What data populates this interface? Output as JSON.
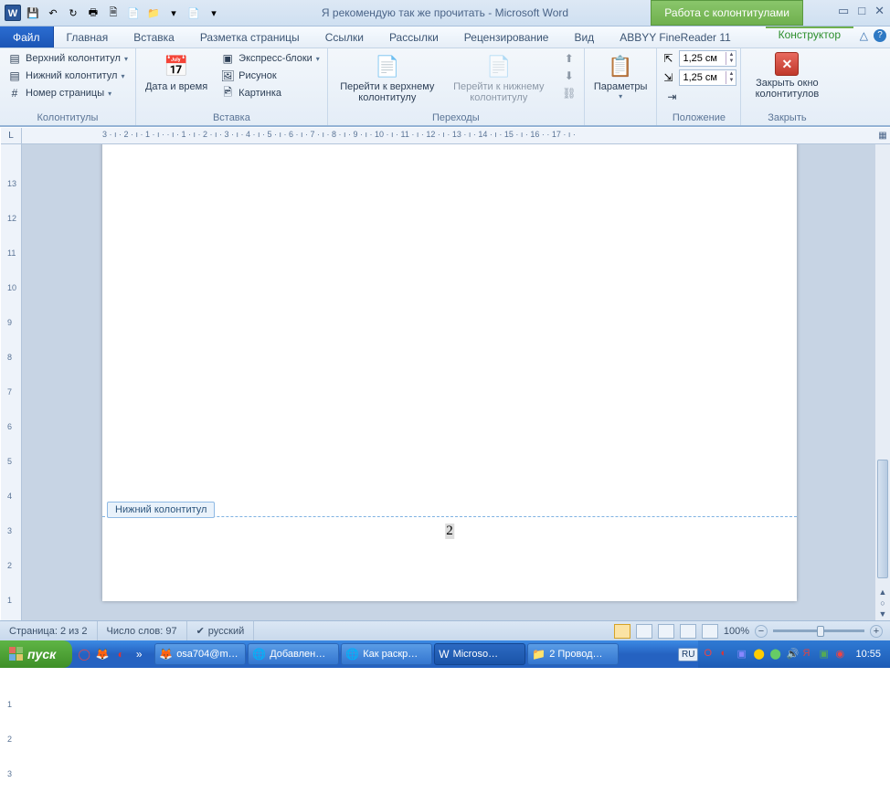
{
  "title": "Я рекомендую так же прочитать - Microsoft Word",
  "contextTab": "Работа с колонтитулами",
  "tabs": {
    "file": "Файл",
    "home": "Главная",
    "insert": "Вставка",
    "layout": "Разметка страницы",
    "refs": "Ссылки",
    "mail": "Рассылки",
    "review": "Рецензирование",
    "view": "Вид",
    "abbyy": "ABBYY FineReader 11",
    "constructor": "Конструктор"
  },
  "ribbon": {
    "group1": {
      "label": "Колонтитулы",
      "topHeader": "Верхний колонтитул",
      "bottomHeader": "Нижний колонтитул",
      "pageNum": "Номер страницы"
    },
    "group2": {
      "label": "Вставка",
      "datetime": "Дата и время",
      "express": "Экспресс-блоки",
      "picture": "Рисунок",
      "clipart": "Картинка"
    },
    "group3": {
      "label": "Переходы",
      "goTop": "Перейти к верхнему колонтитулу",
      "goBottom": "Перейти к нижнему колонтитулу"
    },
    "group4": {
      "paramsLabel": "Параметры"
    },
    "group5": {
      "label": "Положение",
      "val1": "1,25 см",
      "val2": "1,25 см"
    },
    "group6": {
      "label": "Закрыть",
      "closeBtn": "Закрыть окно колонтитулов"
    }
  },
  "hruler": "3 · ı · 2 · ı · 1 · ı ·   · ı · 1 · ı · 2 · ı · 3 · ı · 4 · ı · 5 · ı · 6 · ı · 7 · ı · 8 · ı · 9 · ı · 10 · ı · 11 · ı · 12 · ı · 13 · ı · 14 · ı · 15 · ı · 16 ·   · 17 · ı ·",
  "vruler": [
    "",
    "13",
    "12",
    "11",
    "10",
    "9",
    "8",
    "7",
    "6",
    "5",
    "4",
    "3",
    "2",
    "1",
    "",
    "",
    "1",
    "2",
    "3"
  ],
  "doc": {
    "footerTag": "Нижний колонтитул",
    "pageNum": "2"
  },
  "status": {
    "page": "Страница: 2 из 2",
    "words": "Число слов: 97",
    "lang": "русский",
    "zoom": "100%"
  },
  "taskbar": {
    "start": "пуск",
    "items": [
      {
        "label": "osa704@m…"
      },
      {
        "label": "Добавлен…"
      },
      {
        "label": "Как раскр…"
      },
      {
        "label": "Microso…",
        "active": true
      },
      {
        "label": "2 Провод…"
      }
    ],
    "lang": "RU",
    "clock": "10:55"
  }
}
